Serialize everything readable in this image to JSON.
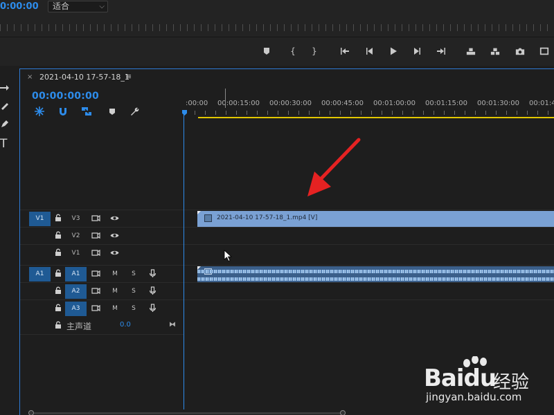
{
  "monitor": {
    "timecode": "0:00:00",
    "fit_value": "适合"
  },
  "timeline": {
    "sequence_name": "2021-04-10 17-57-18_1",
    "close_glyph": "×",
    "menu_glyph": "≡",
    "timecode": "00:00:00:00",
    "ruler_labels": [
      ":00:00",
      "00:00:15:00",
      "00:00:30:00",
      "00:00:45:00",
      "00:01:00:00",
      "00:01:15:00",
      "00:01:30:00",
      "00:01:4"
    ],
    "video_tracks": [
      {
        "source": "V1",
        "name": "V3",
        "has_clip": true
      },
      {
        "source": "",
        "name": "V2",
        "has_clip": false
      },
      {
        "source": "",
        "name": "V1",
        "has_clip": false
      }
    ],
    "audio_tracks": [
      {
        "source": "A1",
        "name": "A1",
        "mute": "M",
        "solo": "S",
        "has_clip": true
      },
      {
        "source": "",
        "name": "A2",
        "mute": "M",
        "solo": "S",
        "has_clip": false
      },
      {
        "source": "",
        "name": "A3",
        "mute": "M",
        "solo": "S",
        "has_clip": false
      }
    ],
    "video_clip_label": "2021-04-10 17-57-18_1.mp4 [V]",
    "master": {
      "name": "主声道",
      "value": "0.0"
    }
  },
  "watermark": {
    "logo": "Baidu",
    "brand": "经验",
    "url": "jingyan.baidu.com"
  },
  "colors": {
    "accent": "#2d8ceb",
    "video_clip": "#7aa1d4",
    "audio_clip": "#3b5f8a",
    "work_area": "#e3c700",
    "annotation": "#e52222"
  }
}
